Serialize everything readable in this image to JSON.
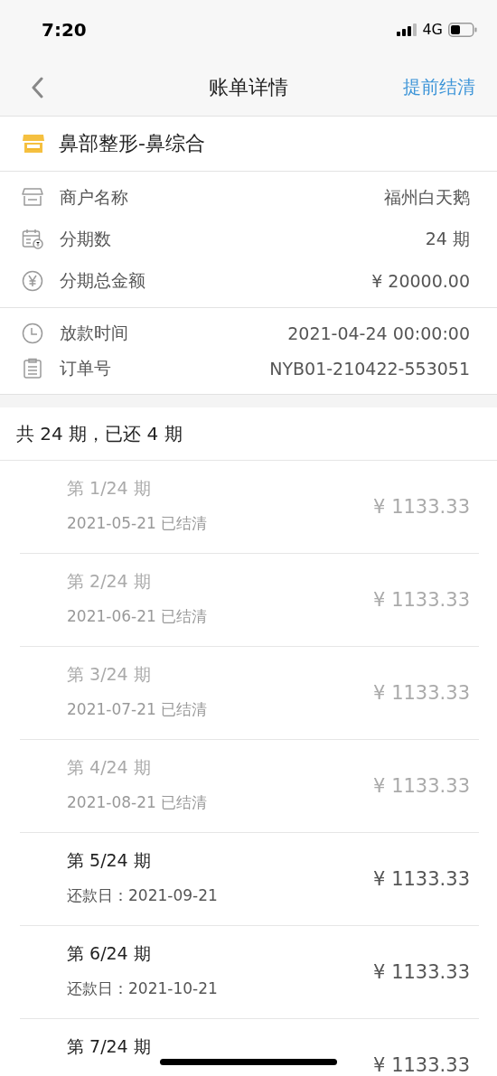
{
  "status_bar": {
    "time": "7:20",
    "network": "4G"
  },
  "nav": {
    "title": "账单详情",
    "action": "提前结清"
  },
  "product": {
    "name": "鼻部整形-鼻综合"
  },
  "info_groups": [
    [
      {
        "kind": "store",
        "label": "商户名称",
        "value": "福州白天鹅"
      },
      {
        "kind": "calendar",
        "label": "分期数",
        "value": "24 期"
      },
      {
        "kind": "yen",
        "label": "分期总金额",
        "value": "¥ 20000.00"
      }
    ],
    [
      {
        "kind": "clock",
        "label": "放款时间",
        "value": "2021-04-24 00:00:00"
      },
      {
        "kind": "clipboard",
        "label": "订单号",
        "value": "NYB01-210422-553051"
      }
    ]
  ],
  "summary": "共 24 期，已还 4 期",
  "installments": [
    {
      "title": "第 1/24 期",
      "subtitle": "2021-05-21 已结清",
      "amount": "¥ 1133.33",
      "settled": true
    },
    {
      "title": "第 2/24 期",
      "subtitle": "2021-06-21 已结清",
      "amount": "¥ 1133.33",
      "settled": true
    },
    {
      "title": "第 3/24 期",
      "subtitle": "2021-07-21 已结清",
      "amount": "¥ 1133.33",
      "settled": true
    },
    {
      "title": "第 4/24 期",
      "subtitle": "2021-08-21 已结清",
      "amount": "¥ 1133.33",
      "settled": true
    },
    {
      "title": "第 5/24 期",
      "subtitle": "还款日：2021-09-21",
      "amount": "¥ 1133.33",
      "settled": false
    },
    {
      "title": "第 6/24 期",
      "subtitle": "还款日：2021-10-21",
      "amount": "¥ 1133.33",
      "settled": false
    },
    {
      "title": "第 7/24 期",
      "amount": "¥ 1133.33",
      "settled": false
    }
  ]
}
